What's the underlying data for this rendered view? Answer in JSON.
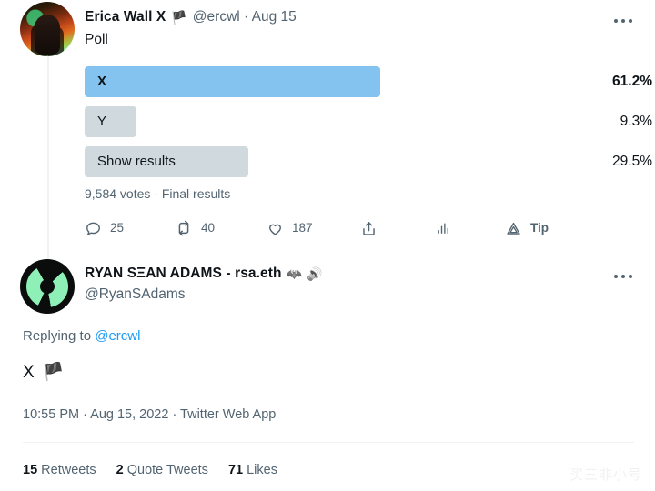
{
  "thread": {
    "tweet1": {
      "author": {
        "display_name": "Erica Wall X",
        "badge_icon": "black-flag-emoji",
        "badge_glyph": "🏴",
        "handle_and_date": "@ercwl · Aug 15"
      },
      "body": "Poll",
      "poll": {
        "options": [
          {
            "label": "X",
            "percent": "61.2%",
            "value": 61.2,
            "winner": true
          },
          {
            "label": "Y",
            "percent": "9.3%",
            "value": 9.3,
            "winner": false
          },
          {
            "label": "Show results",
            "percent": "29.5%",
            "value": 29.5,
            "winner": false
          }
        ],
        "meta": "9,584 votes · Final results"
      },
      "actions": {
        "reply_count": "25",
        "retweet_count": "40",
        "like_count": "187",
        "share_label": "",
        "analytics_label": "",
        "tip_label": "Tip"
      },
      "more_menu": "•••"
    },
    "tweet2": {
      "author": {
        "display_name": "RYAN SΞAN ADAMS - rsa.eth",
        "emoji1": "🦇",
        "emoji2": "🔊",
        "handle": "@RyanSAdams"
      },
      "replying_prefix": "Replying to ",
      "replying_handle": "@ercwl",
      "body_text": "X",
      "body_emoji": "🏴",
      "timestamp": "10:55 PM · Aug 15, 2022 · Twitter Web App",
      "more_menu": "•••",
      "stats": [
        {
          "num": "15",
          "label": "Retweets"
        },
        {
          "num": "2",
          "label": "Quote Tweets"
        },
        {
          "num": "71",
          "label": "Likes"
        }
      ]
    }
  },
  "watermark": "买三非小号",
  "colors": {
    "poll_winner_bar": "#84c2ef",
    "poll_other_bar": "#cfd9de",
    "link_blue": "#1d9bf0",
    "muted_text": "#536471",
    "primary_text": "#0f1419",
    "divider": "#eff3f4"
  }
}
